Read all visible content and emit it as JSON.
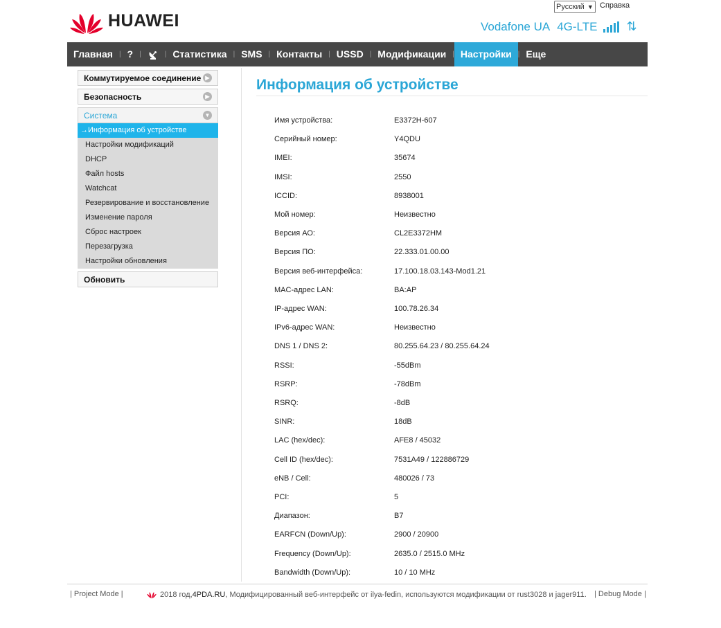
{
  "header": {
    "language": "Русский",
    "help": "Справка",
    "brand": "HUAWEI",
    "operator": "Vodafone UA",
    "network_type": "4G-LTE"
  },
  "nav": [
    {
      "label": "Главная"
    },
    {
      "label": "?"
    },
    {
      "label": ""
    },
    {
      "label": "Статистика"
    },
    {
      "label": "SMS"
    },
    {
      "label": "Контакты"
    },
    {
      "label": "USSD"
    },
    {
      "label": "Модификации"
    },
    {
      "label": "Настройки"
    },
    {
      "label": "Еще"
    }
  ],
  "sidebar": {
    "dialup": "Коммутируемое соединение",
    "security": "Безопасность",
    "system": "Система",
    "items": [
      "Информация об устройстве",
      "Настройки модификаций",
      "DHCP",
      "Файл hosts",
      "Watchcat",
      "Резервирование и восстановление",
      "Изменение пароля",
      "Сброс настроек",
      "Перезагрузка",
      "Настройки обновления"
    ],
    "update": "Обновить"
  },
  "page_title": "Информация об устройстве",
  "device_info": [
    {
      "label": "Имя устройства:",
      "value": "E3372H-607"
    },
    {
      "label": "Серийный номер:",
      "value": "Y4QDU"
    },
    {
      "label": "IMEI:",
      "value": "35674"
    },
    {
      "label": "IMSI:",
      "value": "2550"
    },
    {
      "label": "ICCID:",
      "value": "8938001"
    },
    {
      "label": "Мой номер:",
      "value": "Неизвестно"
    },
    {
      "label": "Версия АО:",
      "value": "CL2E3372HM"
    },
    {
      "label": "Версия ПО:",
      "value": "22.333.01.00.00"
    },
    {
      "label": "Версия веб-интерфейса:",
      "value": "17.100.18.03.143-Mod1.21"
    },
    {
      "label": "MAC-адрес LAN:",
      "value": "BA:AP"
    },
    {
      "label": "IP-адрес WAN:",
      "value": "100.78.26.34"
    },
    {
      "label": "IPv6-адрес WAN:",
      "value": "Неизвестно"
    },
    {
      "label": "DNS 1 / DNS 2:",
      "value": "80.255.64.23 / 80.255.64.24"
    },
    {
      "label": "RSSI:",
      "value": "-55dBm"
    },
    {
      "label": "RSRP:",
      "value": "-78dBm"
    },
    {
      "label": "RSRQ:",
      "value": "-8dB"
    },
    {
      "label": "SINR:",
      "value": "18dB"
    },
    {
      "label": "LAC (hex/dec):",
      "value": "AFE8 / 45032"
    },
    {
      "label": "Cell ID (hex/dec):",
      "value": "7531A49 / 122886729"
    },
    {
      "label": "eNB / Cell:",
      "value": "480026 / 73"
    },
    {
      "label": "PCI:",
      "value": "5"
    },
    {
      "label": "Диапазон:",
      "value": "B7"
    },
    {
      "label": "EARFCN (Down/Up):",
      "value": "2900 / 20900"
    },
    {
      "label": "Frequency (Down/Up):",
      "value": "2635.0 / 2515.0 MHz"
    },
    {
      "label": "Bandwidth (Down/Up):",
      "value": "10 / 10 MHz"
    }
  ],
  "footer": {
    "project_mode": "Project Mode",
    "copyright_prefix": "2018 год, ",
    "site": "4PDA.RU",
    "copyright_suffix": ", Модифицированный веб-интерфейс от ilya-fedin, используются модификации от rust3028 и jager911.",
    "debug_mode": "Debug Mode"
  },
  "colors": {
    "accent": "#2aa6d6",
    "nav_bg": "#474747",
    "nav_active": "#2ea9d9",
    "sidebar_active": "#1fb4ea",
    "huawei_red": "#e4002b"
  },
  "icons": {
    "logo": "huawei-petal-logo",
    "signal": "signal-strength-icon",
    "transfer": "data-transfer-arrows-icon",
    "satellite": "satellite-dish-icon",
    "expand": "expand-circle-icon"
  }
}
